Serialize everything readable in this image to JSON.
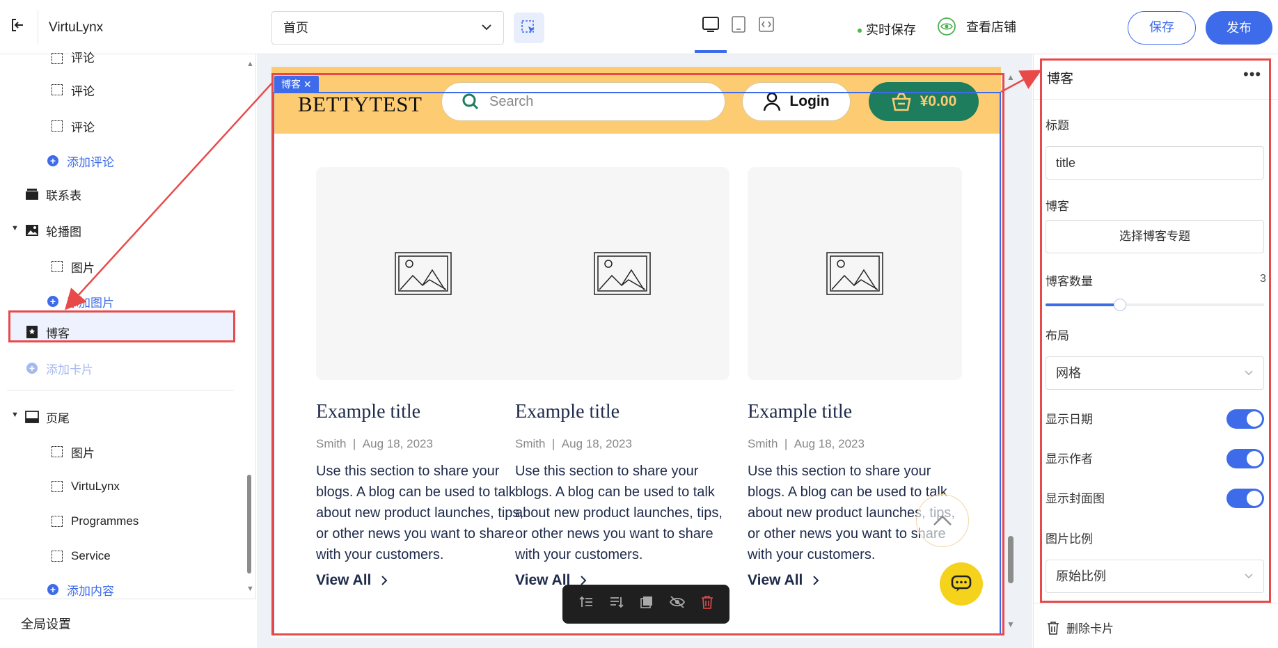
{
  "topbar": {
    "brand": "VirtuLynx",
    "page_select": "首页",
    "autosave": "实时保存",
    "view_store": "查看店铺",
    "save": "保存",
    "publish": "发布"
  },
  "sidebar": {
    "items": [
      {
        "label": "评论"
      },
      {
        "label": "评论"
      },
      {
        "label": "评论"
      },
      {
        "label": "添加评论"
      },
      {
        "label": "联系表"
      },
      {
        "label": "轮播图"
      },
      {
        "label": "图片"
      },
      {
        "label": "添加图片"
      },
      {
        "label": "博客"
      },
      {
        "label": "添加卡片"
      },
      {
        "label": "页尾"
      },
      {
        "label": "图片"
      },
      {
        "label": "VirtuLynx"
      },
      {
        "label": "Programmes"
      },
      {
        "label": "Service"
      },
      {
        "label": "添加内容"
      }
    ],
    "global_settings": "全局设置"
  },
  "preview": {
    "logo": "BETTYTEST",
    "search_placeholder": "Search",
    "login": "Login",
    "cart": "¥0.00",
    "selection_tag": "博客",
    "cards": [
      {
        "title": "Example title",
        "author": "Smith",
        "date": "Aug 18, 2023",
        "body": "Use this section to share your blogs. A blog can be used to talk about new product launches, tips, or other news you want to share with your customers.",
        "link": "View All"
      },
      {
        "title": "Example title",
        "author": "Smith",
        "date": "Aug 18, 2023",
        "body": "Use this section to share your blogs. A blog can be used to talk about new product launches, tips, or other news you want to share with your customers.",
        "link": "View All"
      },
      {
        "title": "Example title",
        "author": "Smith",
        "date": "Aug 18, 2023",
        "body": "Use this section to share your blogs. A blog can be used to talk about new product launches, tips, or other news you want to share with your customers.",
        "link": "View All"
      }
    ]
  },
  "panel": {
    "heading": "博客",
    "title_label": "标题",
    "title_value": "title",
    "blog_label": "博客",
    "blog_button": "选择博客专题",
    "count_label": "博客数量",
    "count_value": "3",
    "count_fraction": 0.34,
    "layout_label": "布局",
    "layout_value": "网格",
    "show_date": "显示日期",
    "show_author": "显示作者",
    "show_cover": "显示封面图",
    "ratio_label": "图片比例",
    "ratio_value": "原始比例",
    "delete_card": "删除卡片"
  },
  "colors": {
    "accent": "#3e6bea",
    "highlight": "#e84a4a",
    "header_bg": "#fdcc72",
    "cart_bg": "#1d7d5c"
  }
}
